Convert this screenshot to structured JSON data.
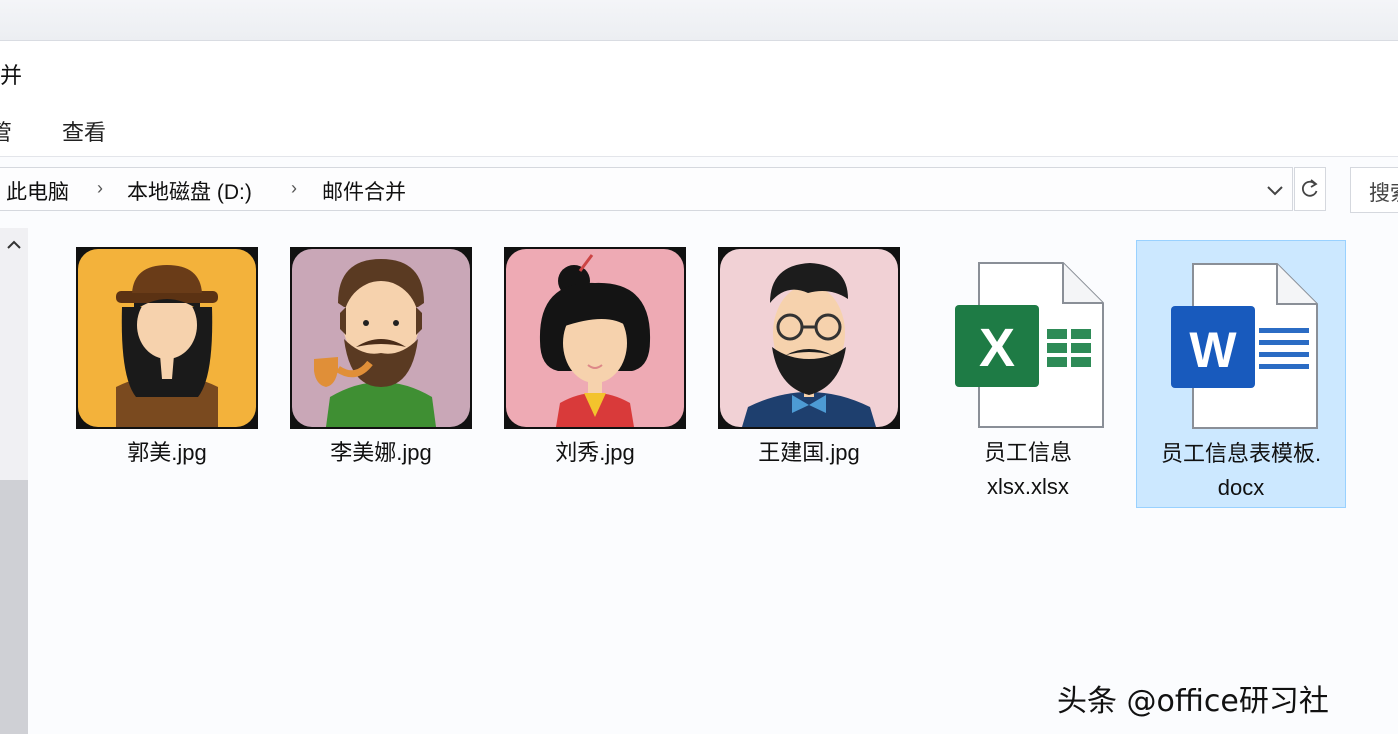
{
  "window": {
    "title_fragment": "并"
  },
  "ribbon": {
    "tab_cut": "管",
    "tab_view": "查看"
  },
  "breadcrumb": {
    "items": [
      "此电脑",
      "本地磁盘 (D:)",
      "邮件合并"
    ],
    "separator": "›"
  },
  "search": {
    "label": "搜索"
  },
  "files": [
    {
      "name": "郭美.jpg",
      "icon": "woman-hat-avatar-icon",
      "selected": false
    },
    {
      "name": "李美娜.jpg",
      "icon": "bearded-man-pipe-avatar-icon",
      "selected": false
    },
    {
      "name": "刘秀.jpg",
      "icon": "woman-bun-avatar-icon",
      "selected": false
    },
    {
      "name": "王建国.jpg",
      "icon": "man-glasses-avatar-icon",
      "selected": false
    },
    {
      "name_line1": "员工信息",
      "name_line2": "xlsx.xlsx",
      "icon": "excel-file-icon",
      "selected": false
    },
    {
      "name_line1": "员工信息表模板.",
      "name_line2": "docx",
      "icon": "word-file-icon",
      "selected": true
    }
  ],
  "watermark": "头条 @office研习社",
  "colors": {
    "selection_bg": "#cce8ff",
    "selection_border": "#99d1ff",
    "excel_green": "#1e7b45",
    "word_blue": "#185abd"
  }
}
